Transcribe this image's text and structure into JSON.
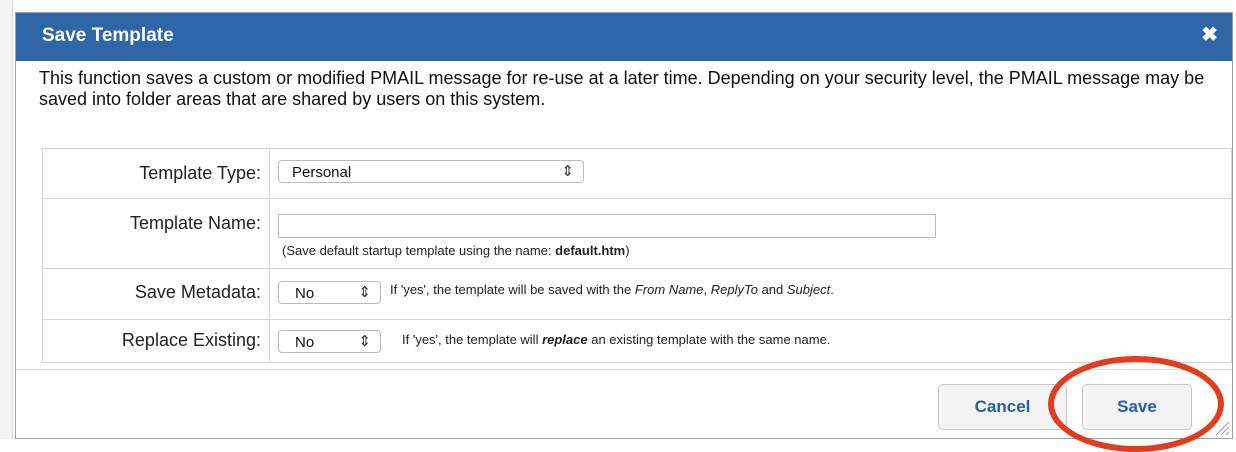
{
  "dialog": {
    "title": "Save Template",
    "close_glyph": "✖",
    "description": "This function saves a custom or modified PMAIL message for re-use at a later time. Depending on your security level, the PMAIL message may be saved into folder areas that are shared by users on this system.",
    "title_bar_color": "#2e66a8"
  },
  "form": {
    "template_type": {
      "label": "Template Type:",
      "value": "Personal"
    },
    "template_name": {
      "label": "Template Name:",
      "value": "",
      "hint_prefix": "(Save default startup template using the name: ",
      "hint_bold": "default.htm",
      "hint_suffix": ")"
    },
    "save_metadata": {
      "label": "Save Metadata:",
      "value": "No",
      "hint_1": "If 'yes', the template will be saved with the ",
      "hint_italic_1": "From Name",
      "hint_2": ", ",
      "hint_italic_2": "ReplyTo",
      "hint_3": " and ",
      "hint_italic_3": "Subject",
      "hint_4": "."
    },
    "replace_existing": {
      "label": "Replace Existing:",
      "value": "No",
      "hint_1": "If 'yes', the template will ",
      "hint_bold_italic": "replace",
      "hint_2": " an existing template with the same name."
    }
  },
  "buttons": {
    "cancel": "Cancel",
    "save": "Save"
  },
  "icons": {
    "select_caret": "select-caret-icon",
    "close": "close-icon",
    "resize": "resize-grip-icon"
  },
  "accent_color": "#e23c1f"
}
